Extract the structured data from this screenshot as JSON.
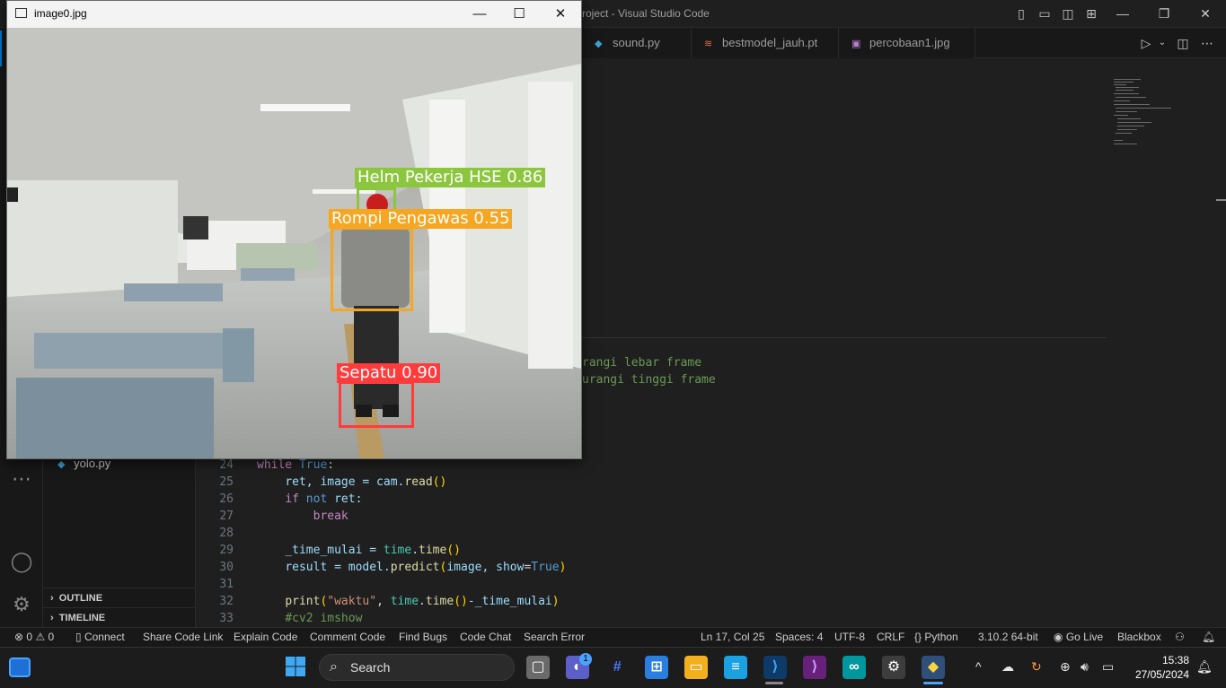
{
  "vscode": {
    "title": "roject - Visual Studio Code",
    "tabs": [
      {
        "label": "sound.py",
        "icon": "python-icon"
      },
      {
        "label": "bestmodel_jauh.pt",
        "icon": "file-icon"
      },
      {
        "label": "percobaan1.jpg",
        "icon": "image-icon"
      }
    ],
    "sidebar": {
      "file": "yolo.py",
      "outline": "OUTLINE",
      "timeline": "TIMELINE"
    },
    "code_comments": [
      "rangi lebar frame",
      "urangi tinggi frame"
    ],
    "code": [
      {
        "n": "24"
      },
      {
        "n": "25"
      },
      {
        "n": "26"
      },
      {
        "n": "27"
      },
      {
        "n": "28"
      },
      {
        "n": "29"
      },
      {
        "n": "30"
      },
      {
        "n": "31"
      },
      {
        "n": "32"
      },
      {
        "n": "33"
      }
    ],
    "code_tokens": {
      "l24a": "while",
      "l24b": "True",
      "l24c": ":",
      "l25a": "ret, image = cam.",
      "l25b": "read",
      "l25c": "()",
      "l26a": "if",
      "l26b": "not",
      "l26c": " ret:",
      "l27a": "break",
      "l29a": "_time_mulai = ",
      "l29b": "time",
      "l29c": ".",
      "l29d": "time",
      "l29e": "()",
      "l30a": "result = model.",
      "l30b": "predict",
      "l30c": "(",
      "l30d": "image, ",
      "l30e": "show",
      "l30f": "=",
      "l30g": "True",
      "l30h": ")",
      "l32a": "print",
      "l32b": "(",
      "l32c": "\"waktu\"",
      "l32d": ", ",
      "l32e": "time",
      "l32f": ".",
      "l32g": "time",
      "l32h": "()",
      "l32i": "-_time_mulai",
      "l32j": ")",
      "l33a": "#cv2 imshow"
    },
    "statusbar": {
      "errors": "0",
      "warnings": "0",
      "connect": "Connect",
      "share": "Share Code Link",
      "explain": "Explain Code",
      "comment": "Comment Code",
      "bugs": "Find Bugs",
      "chat": "Code Chat",
      "search_error": "Search Error",
      "position": "Ln 17, Col 25",
      "spaces": "Spaces: 4",
      "encoding": "UTF-8",
      "eol": "CRLF",
      "language": "Python",
      "interpreter": "3.10.2 64-bit",
      "golive": "Go Live",
      "blackbox": "Blackbox"
    }
  },
  "image_window": {
    "title": "image0.jpg",
    "detections": [
      {
        "label": "Helm Pekerja HSE 0.86",
        "color": "#8cc63f"
      },
      {
        "label": "Rompi Pengawas 0.55",
        "color": "#f5a623"
      },
      {
        "label": "Sepatu 0.90",
        "color": "#ff3b3b"
      }
    ]
  },
  "taskbar": {
    "search_placeholder": "Search",
    "chat_badge": "1",
    "time": "15:38",
    "date": "27/05/2024"
  }
}
